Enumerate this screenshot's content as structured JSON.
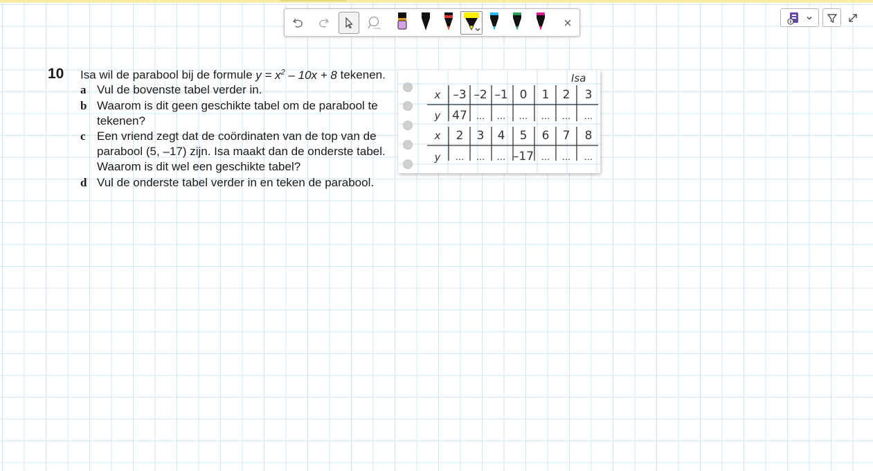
{
  "toolbar": {
    "undo_icon": "undo-icon",
    "redo_icon": "redo-icon",
    "select_icon": "cursor-icon",
    "lasso_icon": "lasso-icon",
    "close_icon": "close-icon",
    "pens": [
      {
        "name": "pink-highlighter",
        "color": "#d8a2e6"
      },
      {
        "name": "black-pen",
        "color": "#111111"
      },
      {
        "name": "red-pen",
        "color": "#e53935"
      },
      {
        "name": "yellow-highlighter",
        "color": "#ffee00"
      },
      {
        "name": "blue-pen",
        "color": "#29b6f6"
      },
      {
        "name": "green-pen",
        "color": "#2e9e5b"
      },
      {
        "name": "magenta-pen",
        "color": "#d81b8c"
      }
    ]
  },
  "right_controls": {
    "accessibility_icon": "reader-icon",
    "filter_icon": "funnel-icon",
    "expand_icon": "expand-icon"
  },
  "exercise": {
    "number": "10",
    "intro_pre": "Isa wil de parabool bij de formule ",
    "formula_main": "y = x",
    "formula_exp": "2",
    "formula_rest": " – 10x + 8",
    "intro_post": " tekenen.",
    "a_letter": "a",
    "a_text": "Vul de bovenste tabel verder in.",
    "b_letter": "b",
    "b_line1": "Waarom is dit geen geschikte tabel om de parabool te",
    "b_line2": "tekenen?",
    "c_letter": "c",
    "c_line1": "Een vriend zegt dat de coördinaten van de top van de",
    "c_line2": "parabool (5, –17) zijn. Isa maakt dan de onderste tabel.",
    "c_line3": "Waarom is dit wel een geschikte tabel?",
    "d_letter": "d",
    "d_text": "Vul de onderste tabel verder in en teken de parabool."
  },
  "notebook": {
    "owner": "Isa",
    "table1": {
      "x_label": "x",
      "y_label": "y",
      "x": [
        "–3",
        "–2",
        "–1",
        "0",
        "1",
        "2",
        "3"
      ],
      "y": [
        "47",
        "...",
        "...",
        "...",
        "...",
        "...",
        "..."
      ]
    },
    "table2": {
      "x_label": "x",
      "y_label": "y",
      "x": [
        "2",
        "3",
        "4",
        "5",
        "6",
        "7",
        "8"
      ],
      "y": [
        "...",
        "...",
        "...",
        "–17",
        "...",
        "...",
        "..."
      ]
    }
  }
}
